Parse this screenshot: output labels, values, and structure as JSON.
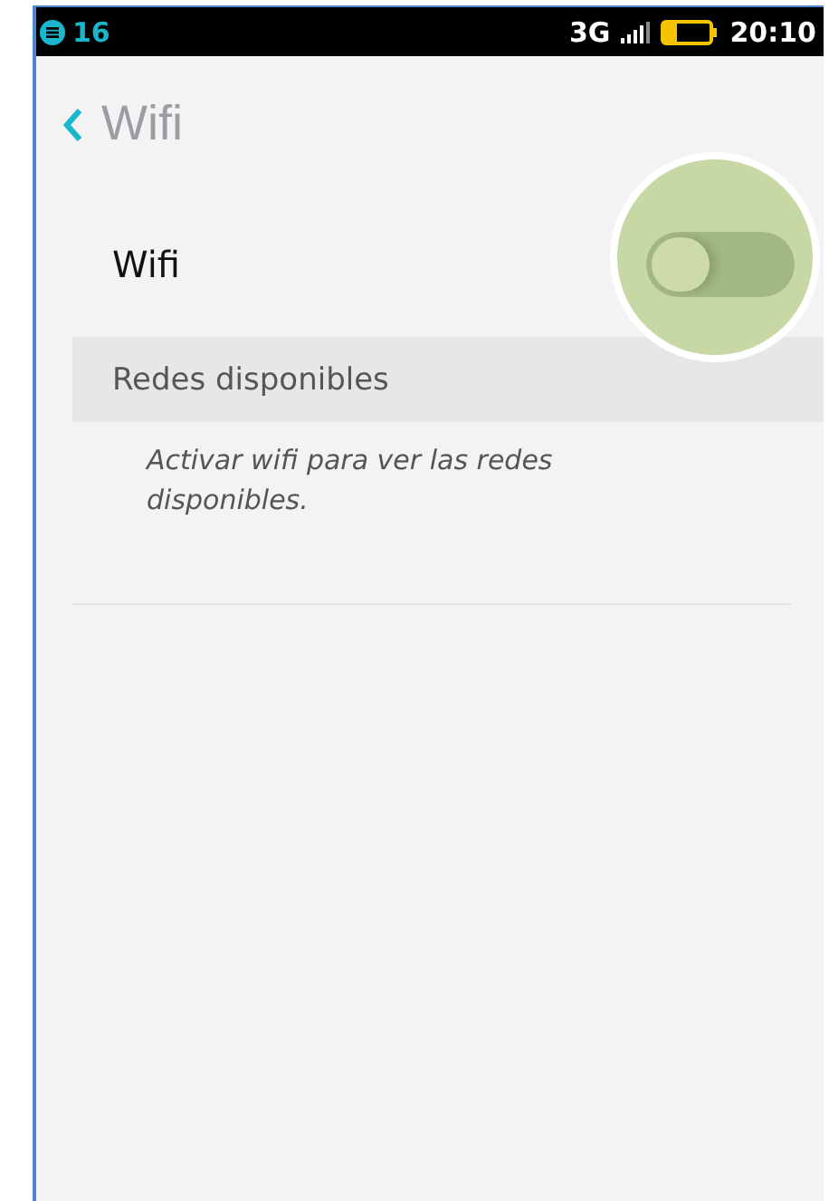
{
  "status_bar": {
    "notification_count": "16",
    "network": "3G",
    "time": "20:10"
  },
  "header": {
    "title": "Wifi"
  },
  "wifi_setting": {
    "label": "Wifi",
    "on": false,
    "highlighted": true
  },
  "available_networks": {
    "heading": "Redes disponibles",
    "message": "Activar wifi para ver las redes disponibles."
  }
}
